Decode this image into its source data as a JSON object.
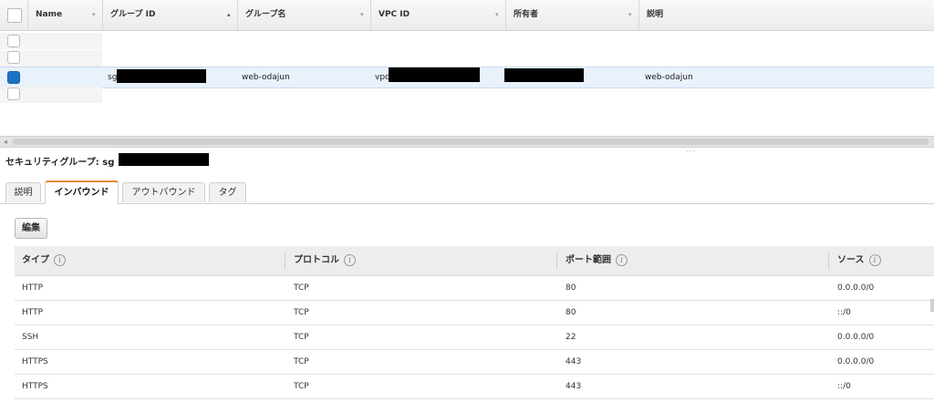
{
  "grid": {
    "columns": [
      {
        "label": "Name",
        "sort": "▾"
      },
      {
        "label": "グループ ID",
        "sort": "▴"
      },
      {
        "label": "グループ名",
        "sort": "▾"
      },
      {
        "label": "VPC ID",
        "sort": "▾"
      },
      {
        "label": "所有者",
        "sort": "▾"
      },
      {
        "label": "説明",
        "sort": ""
      }
    ],
    "selected_row": {
      "group_id_prefix": "sg",
      "group_name": "web-odajun",
      "vpc_prefix": "vpc",
      "description": "web-odajun"
    }
  },
  "detail": {
    "title_prefix": "セキュリティグループ: sg",
    "tabs": [
      "説明",
      "インバウンド",
      "アウトバウンド",
      "タグ"
    ],
    "active_tab": "インバウンド",
    "edit_label": "編集",
    "table": {
      "headers": [
        "タイプ",
        "プロトコル",
        "ポート範囲",
        "ソース"
      ],
      "info_glyph": "i",
      "rows": [
        [
          "HTTP",
          "TCP",
          "80",
          "0.0.0.0/0"
        ],
        [
          "HTTP",
          "TCP",
          "80",
          "::/0"
        ],
        [
          "SSH",
          "TCP",
          "22",
          "0.0.0.0/0"
        ],
        [
          "HTTPS",
          "TCP",
          "443",
          "0.0.0.0/0"
        ],
        [
          "HTTPS",
          "TCP",
          "443",
          "::/0"
        ]
      ]
    }
  },
  "icons": {
    "scroll_left": "◂",
    "splitter": "---"
  },
  "colors": {
    "accent_tab": "#e8892f",
    "checkbox_selected": "#1a73c8",
    "selected_row_bg": "#e9f1fb"
  }
}
